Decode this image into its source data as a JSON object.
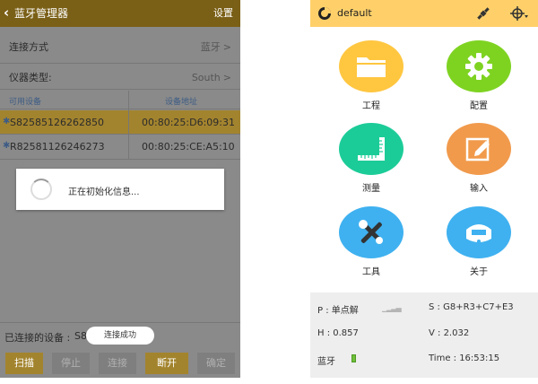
{
  "left_phone": {
    "header": {
      "back_icon": "‹",
      "title": "蓝牙管理器",
      "settings": "设置"
    },
    "connection": {
      "label": "连接方式",
      "value": "蓝牙",
      "chevron": ">"
    },
    "instrument": {
      "label": "仪器类型:",
      "value": "South",
      "chevron": ">"
    },
    "table": {
      "headers": [
        "可用设备",
        "设备地址"
      ],
      "devices": [
        {
          "name": "S82585126262850",
          "address": "00:80:25:D6:09:31",
          "selected": true
        },
        {
          "name": "R82581126246273",
          "address": "00:80:25:CE:A5:10",
          "selected": false
        }
      ]
    },
    "dialog": {
      "text": "正在初始化信息..."
    },
    "status": {
      "label": "已连接的设备 :",
      "value_partial": "S8"
    },
    "toast": "连接成功",
    "buttons": [
      "扫描",
      "停止",
      "连接",
      "断开",
      "确定"
    ],
    "accent_color": "#a3842e"
  },
  "right_phone": {
    "header": {
      "title": "default",
      "icons": [
        "logo-icon",
        "satellite-icon",
        "pole-icon"
      ]
    },
    "tiles": [
      {
        "label": "工程",
        "icon": "folder-icon",
        "color": "#ffc640"
      },
      {
        "label": "配置",
        "icon": "gear-icon",
        "color": "#7ed321"
      },
      {
        "label": "测量",
        "icon": "ruler-icon",
        "color": "#1ccc98"
      },
      {
        "label": "输入",
        "icon": "edit-icon",
        "color": "#f19a4c"
      },
      {
        "label": "工具",
        "icon": "tools-icon",
        "color": "#3fb1f0"
      },
      {
        "label": "关于",
        "icon": "receiver-icon",
        "color": "#3fb1f0"
      }
    ],
    "info": {
      "p": "P : 单点解",
      "s": "S : G8+R3+C7+E3",
      "h": "H : 0.857",
      "v": "V : 2.032",
      "bt": "蓝牙",
      "time": "Time :  16:53:15"
    },
    "header_color": "#ffd06a"
  }
}
